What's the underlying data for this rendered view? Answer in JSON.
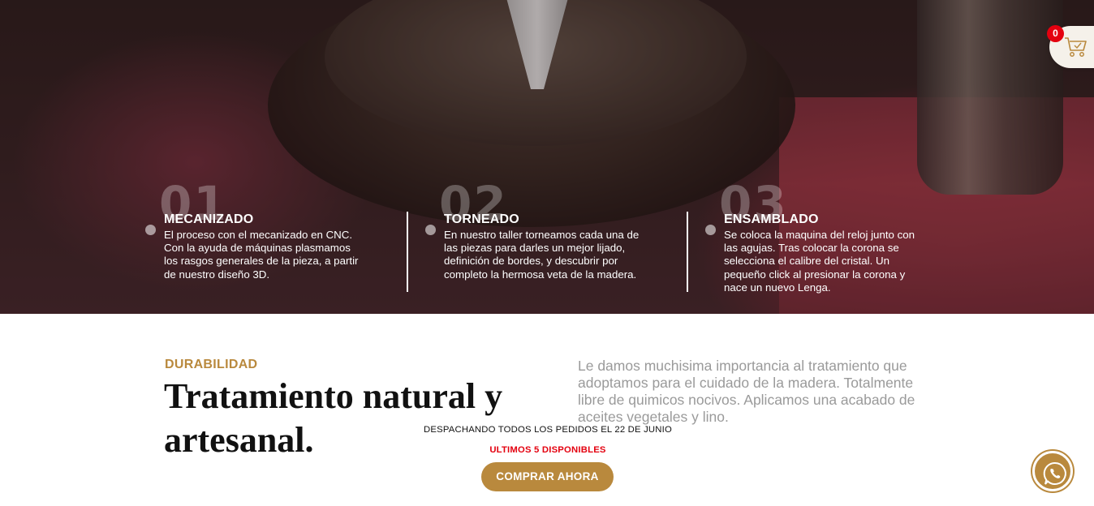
{
  "hero": {
    "steps": [
      {
        "number": "01",
        "title": "MECANIZADO",
        "text": "El proceso con el mecanizado en CNC. Con la ayuda de máquinas plasmamos los rasgos generales de la pieza, a partir de nuestro diseño 3D."
      },
      {
        "number": "02",
        "title": "TORNEADO",
        "text": "En nuestro taller torneamos cada una de las piezas para darles un mejor lijado, definición de bordes, y descubrir por completo la hermosa veta de la madera."
      },
      {
        "number": "03",
        "title": "ENSAMBLADO",
        "text": "Se coloca la maquina del reloj junto con las agujas. Tras colocar la corona se selecciona el calibre del cristal. Un pequeño click al presionar la corona y nace un nuevo Lenga."
      }
    ]
  },
  "cart": {
    "count": "0",
    "icon": "cart-icon"
  },
  "durability": {
    "eyebrow": "DURABILIDAD",
    "heading": "Tratamiento natural y artesanal.",
    "paragraph": "Le damos muchisima importancia al tratamiento que adoptamos para el cuidado de la madera. Totalmente libre de quimicos nocivos. Aplicamos una acabado de aceites vegetales y lino."
  },
  "promo": {
    "shipping": "DESPACHANDO TODOS LOS PEDIDOS EL 22 DE JUNIO",
    "stock": "ULTIMOS 5 DISPONIBLES",
    "button": "COMPRAR AHORA"
  },
  "whatsapp": {
    "icon": "whatsapp-icon"
  },
  "colors": {
    "accent": "#b9893d",
    "alert": "#e4000f",
    "text": "#111111",
    "muted": "#9a9a9a"
  }
}
